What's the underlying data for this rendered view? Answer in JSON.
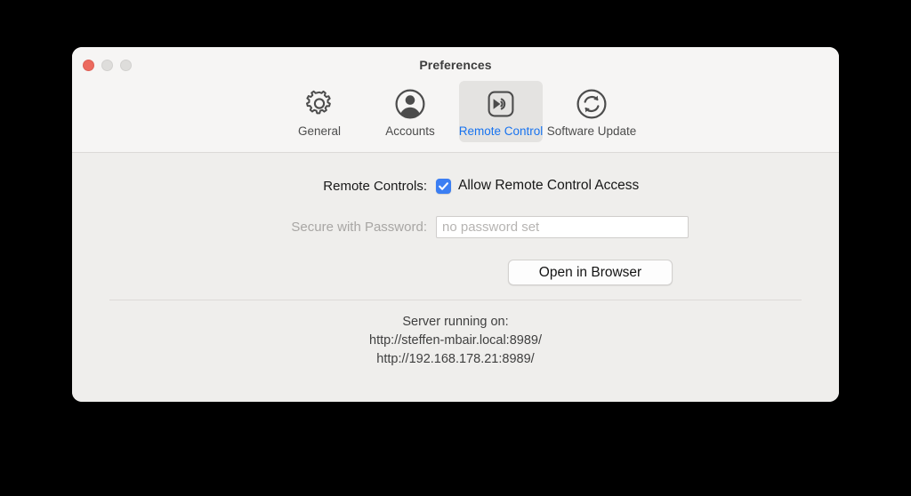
{
  "window": {
    "title": "Preferences",
    "traffic_lights": [
      {
        "name": "close",
        "color": "#ec6a5e"
      },
      {
        "name": "minimize",
        "color": "#dedddb"
      },
      {
        "name": "zoom",
        "color": "#dedddb"
      }
    ]
  },
  "toolbar": {
    "items": [
      {
        "label": "General",
        "icon": "gear-icon",
        "selected": false
      },
      {
        "label": "Accounts",
        "icon": "user-circle-icon",
        "selected": false
      },
      {
        "label": "Remote Control",
        "icon": "remote-control-icon",
        "selected": true
      },
      {
        "label": "Software Update",
        "icon": "refresh-circle-icon",
        "selected": false
      }
    ],
    "selected_color": "#1873ef",
    "label_color": "#4c4c4c"
  },
  "content": {
    "remote_controls": {
      "label": "Remote Controls:",
      "checkbox_label": "Allow Remote Control Access",
      "checked": true,
      "checkbox_color": "#3b7ef3"
    },
    "password": {
      "label": "Secure with Password:",
      "placeholder": "no password set",
      "value": "",
      "disabled": true
    },
    "open_browser_button": "Open in Browser",
    "server": {
      "heading": "Server running on:",
      "urls": [
        "http://steffen-mbair.local:8989/",
        "http://192.168.178.21:8989/"
      ]
    },
    "help_button": "?"
  }
}
